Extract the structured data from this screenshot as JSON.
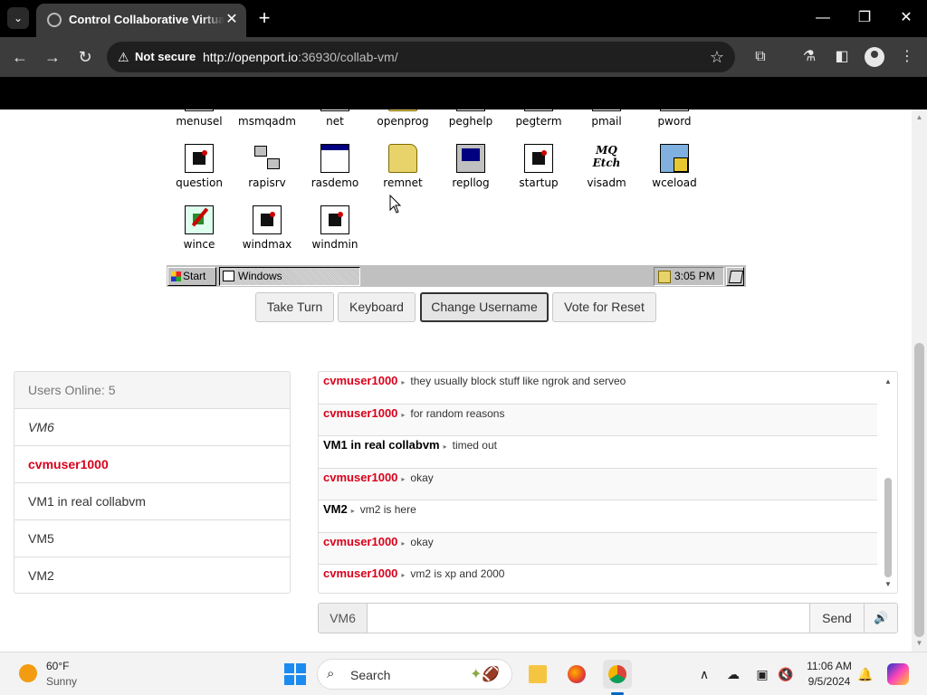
{
  "browser": {
    "tab_title": "Control Collaborative Virtual M",
    "tab_close": "✕",
    "new_tab": "+",
    "security_label": "Not secure",
    "url_host": "http://openport.io",
    "url_rest": ":36930/collab-vm/"
  },
  "vm": {
    "icons": [
      {
        "name": "menusel",
        "glyph": "doc"
      },
      {
        "name": "msmqadm",
        "glyph": "network"
      },
      {
        "name": "net",
        "glyph": "window"
      },
      {
        "name": "openprog",
        "glyph": "folder"
      },
      {
        "name": "peghelp",
        "glyph": "doc"
      },
      {
        "name": "pegterm",
        "glyph": "doc"
      },
      {
        "name": "pmail",
        "glyph": "doc"
      },
      {
        "name": "pword",
        "glyph": "doc"
      },
      {
        "name": "question",
        "glyph": "doc"
      },
      {
        "name": "rapisrv",
        "glyph": "network"
      },
      {
        "name": "rasdemo",
        "glyph": "window"
      },
      {
        "name": "remnet",
        "glyph": "folder"
      },
      {
        "name": "repllog",
        "glyph": "computer"
      },
      {
        "name": "startup",
        "glyph": "doc"
      },
      {
        "name": "visadm",
        "glyph": "visadm",
        "glyph_text": "MQ Etch"
      },
      {
        "name": "wceload",
        "glyph": "wceload"
      },
      {
        "name": "wince",
        "glyph": "wince"
      },
      {
        "name": "windmax",
        "glyph": "doc"
      },
      {
        "name": "windmin",
        "glyph": "doc"
      }
    ],
    "taskbar": {
      "start_label": "Start",
      "task_label": "Windows",
      "clock": "3:05 PM"
    }
  },
  "actions": {
    "take_turn": "Take Turn",
    "keyboard": "Keyboard",
    "change_username": "Change Username",
    "vote_reset": "Vote for Reset"
  },
  "users": {
    "header": "Users Online: 5",
    "list": [
      {
        "name": "VM6",
        "style": "me"
      },
      {
        "name": "cvmuser1000",
        "style": "admin"
      },
      {
        "name": "VM1 in real collabvm",
        "style": "normal"
      },
      {
        "name": "VM5",
        "style": "normal"
      },
      {
        "name": "VM2",
        "style": "normal"
      }
    ]
  },
  "chat": {
    "messages": [
      {
        "user": "cvmuser1000",
        "color": "red",
        "text": "they usually block stuff like ngrok and serveo"
      },
      {
        "user": "cvmuser1000",
        "color": "red",
        "text": "for random reasons"
      },
      {
        "user": "VM1 in real collabvm",
        "color": "black",
        "text": "timed out"
      },
      {
        "user": "cvmuser1000",
        "color": "red",
        "text": "okay"
      },
      {
        "user": "VM2",
        "color": "black",
        "text": "vm2 is here"
      },
      {
        "user": "cvmuser1000",
        "color": "red",
        "text": "okay"
      },
      {
        "user": "cvmuser1000",
        "color": "red",
        "text": "vm2 is xp and 2000"
      }
    ],
    "input": {
      "username": "VM6",
      "value": "",
      "send_label": "Send",
      "sound_icon": "🔊"
    }
  },
  "taskbar": {
    "weather_temp": "60°F",
    "weather_cond": "Sunny",
    "search_label": "Search",
    "time": "11:06 AM",
    "date": "9/5/2024"
  }
}
